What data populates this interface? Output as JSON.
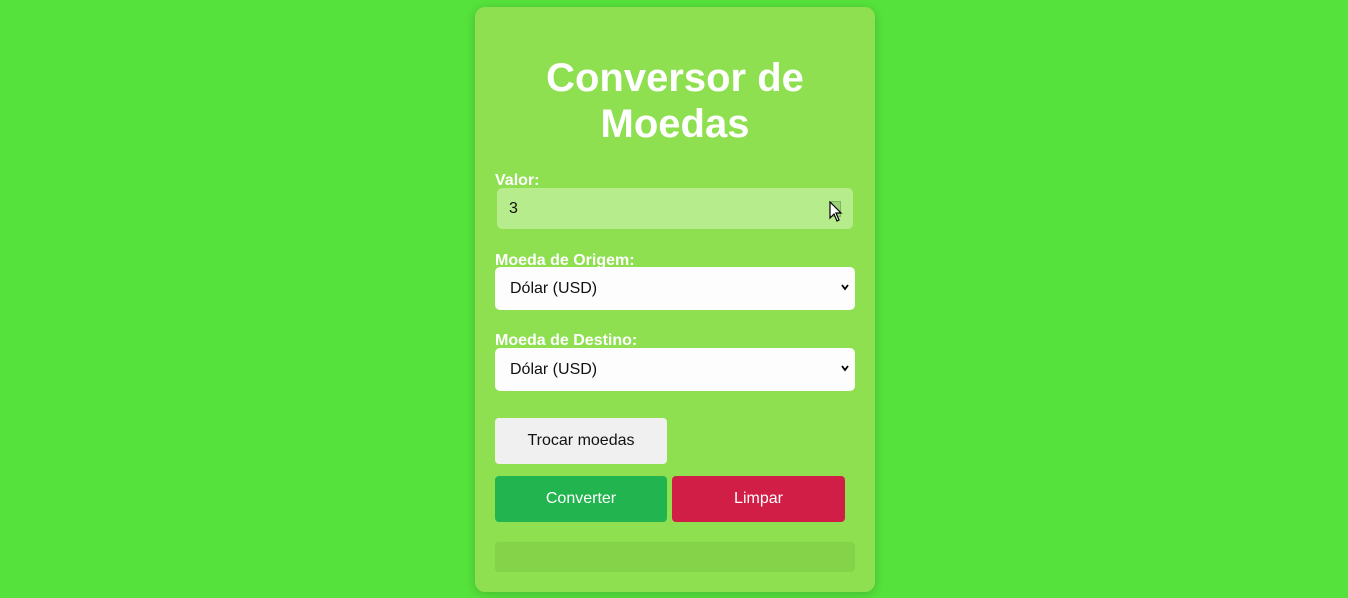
{
  "converter": {
    "title": "Conversor de Moedas",
    "value_label": "Valor:",
    "value": "3",
    "from_label": "Moeda de Origem:",
    "from_selected": "Dólar (USD)",
    "to_label": "Moeda de Destino:",
    "to_selected": "Dólar (USD)",
    "swap_button": "Trocar moedas",
    "convert_button": "Converter",
    "clear_button": "Limpar",
    "result": ""
  },
  "colors": {
    "page_background": "#55e23c",
    "card_background": "#8ee050",
    "convert_button": "#22b54f",
    "clear_button": "#d11e46",
    "swap_button": "#f0f0f0"
  },
  "icons": {
    "select_arrow": "chevron-down-icon",
    "number_spinner": "spinner-icon",
    "mouse_cursor": "cursor-icon"
  }
}
